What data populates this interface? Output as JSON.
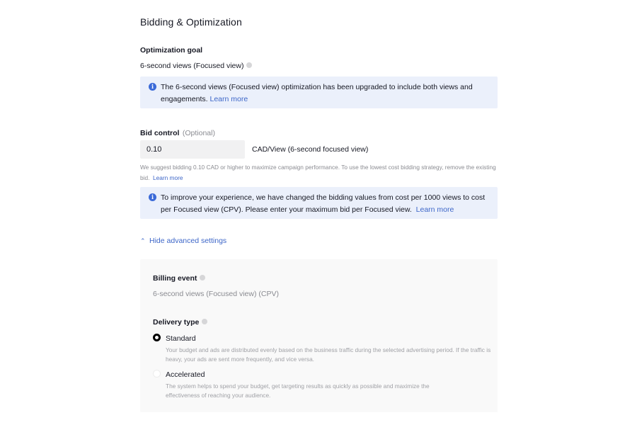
{
  "section": {
    "title": "Bidding & Optimization"
  },
  "optimization_goal": {
    "label": "Optimization goal",
    "value": "6-second views (Focused view)",
    "help_icon": "question-circle-icon",
    "banner": {
      "icon": "info-circle-icon",
      "text": "The 6-second views (Focused view) optimization has been upgraded to include both views and engagements.",
      "link": "Learn more"
    }
  },
  "bid_control": {
    "label": "Bid control",
    "optional": "(Optional)",
    "input_value": "0.10",
    "unit": "CAD/View (6-second focused view)",
    "hint": "We suggest bidding 0.10 CAD or higher to maximize campaign performance. To use the lowest cost bidding strategy, remove the existing bid.",
    "hint_link": "Learn more",
    "banner": {
      "icon": "info-circle-icon",
      "text": "To improve your experience, we have changed the bidding values from cost per 1000 views to cost per Focused view (CPV). Please enter your maximum bid per Focused view.",
      "link": "Learn more"
    }
  },
  "advanced": {
    "toggle_label": "Hide advanced settings",
    "toggle_icon": "double-chevron-up-icon",
    "billing_event": {
      "label": "Billing event",
      "value": "6-second views (Focused view) (CPV)"
    },
    "delivery_type": {
      "label": "Delivery type",
      "selected": "Standard",
      "options": [
        {
          "label": "Standard",
          "description": "Your budget and ads are distributed evenly based on the business traffic during the selected advertising period. If the traffic is heavy, your ads are sent more frequently, and vice versa."
        },
        {
          "label": "Accelerated",
          "description": "The system helps to spend your budget, get targeting results as quickly as possible and maximize the effectiveness of reaching your audience."
        }
      ]
    }
  },
  "colors": {
    "link": "#3d66c8",
    "info_banner_bg": "#ebf0fb",
    "info_icon": "#3b6ad8",
    "panel_bg": "#f9f9f9",
    "input_bg": "#f1f1f2"
  }
}
